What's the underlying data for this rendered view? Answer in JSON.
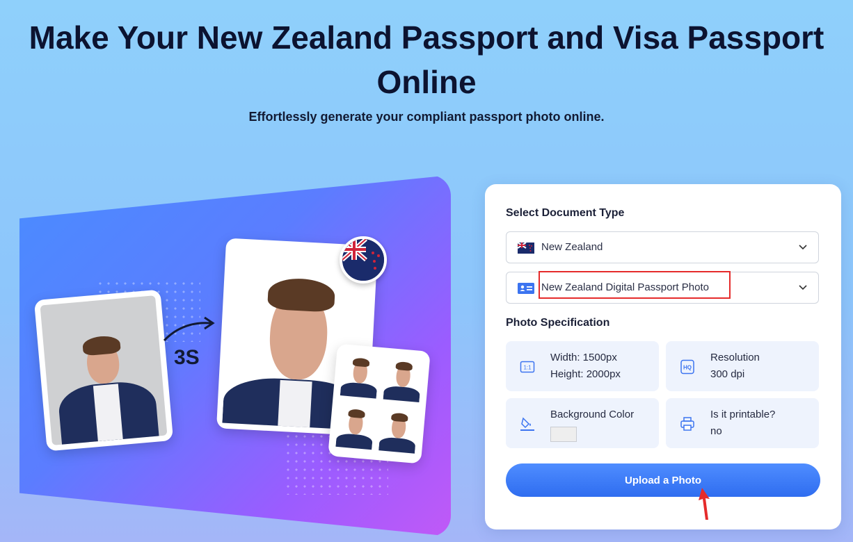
{
  "header": {
    "title": "Make Your New Zealand Passport and Visa Passport Online",
    "subtitle": "Effortlessly generate your compliant passport photo online."
  },
  "hero": {
    "speed_label": "3S",
    "flag_badge_icon": "new-zealand-flag-icon"
  },
  "form": {
    "document_type_label": "Select Document Type",
    "country_select": {
      "value": "New Zealand",
      "icon": "new-zealand-flag-icon"
    },
    "document_select": {
      "value": "New Zealand Digital Passport Photo",
      "icon": "id-card-icon"
    },
    "spec_label": "Photo Specification",
    "specs": {
      "size": {
        "icon": "ratio-icon",
        "line1": "Width: 1500px",
        "line2": "Height: 2000px"
      },
      "resolution": {
        "icon": "hq-icon",
        "line1": "Resolution",
        "line2": "300 dpi"
      },
      "background": {
        "icon": "paint-bucket-icon",
        "line1": "Background Color",
        "color": "#eeeeee"
      },
      "printable": {
        "icon": "printer-icon",
        "line1": "Is it printable?",
        "line2": "no"
      }
    },
    "upload_label": "Upload a Photo"
  },
  "colors": {
    "accent": "#2f6df0",
    "highlight": "#e52b2b",
    "panel_bg": "#ffffff",
    "spec_bg": "#eef3fd"
  }
}
